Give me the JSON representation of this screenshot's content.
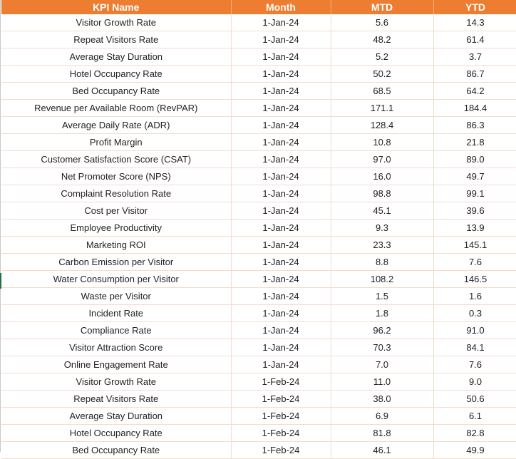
{
  "headers": [
    "KPI Name",
    "Month",
    "MTD",
    "YTD"
  ],
  "rows": [
    [
      "Visitor Growth Rate",
      "1-Jan-24",
      "5.6",
      "14.3"
    ],
    [
      "Repeat Visitors Rate",
      "1-Jan-24",
      "48.2",
      "61.4"
    ],
    [
      "Average Stay Duration",
      "1-Jan-24",
      "5.2",
      "3.7"
    ],
    [
      "Hotel Occupancy Rate",
      "1-Jan-24",
      "50.2",
      "86.7"
    ],
    [
      "Bed Occupancy Rate",
      "1-Jan-24",
      "68.5",
      "64.2"
    ],
    [
      "Revenue per Available Room (RevPAR)",
      "1-Jan-24",
      "171.1",
      "184.4"
    ],
    [
      "Average Daily Rate (ADR)",
      "1-Jan-24",
      "128.4",
      "86.3"
    ],
    [
      "Profit Margin",
      "1-Jan-24",
      "10.8",
      "21.8"
    ],
    [
      "Customer Satisfaction Score (CSAT)",
      "1-Jan-24",
      "97.0",
      "89.0"
    ],
    [
      "Net Promoter Score (NPS)",
      "1-Jan-24",
      "16.0",
      "49.7"
    ],
    [
      "Complaint Resolution Rate",
      "1-Jan-24",
      "98.8",
      "99.1"
    ],
    [
      "Cost per Visitor",
      "1-Jan-24",
      "45.1",
      "39.6"
    ],
    [
      "Employee Productivity",
      "1-Jan-24",
      "9.3",
      "13.9"
    ],
    [
      "Marketing ROI",
      "1-Jan-24",
      "23.3",
      "145.1"
    ],
    [
      "Carbon Emission per Visitor",
      "1-Jan-24",
      "8.8",
      "7.6"
    ],
    [
      "Water Consumption per Visitor",
      "1-Jan-24",
      "108.2",
      "146.5"
    ],
    [
      "Waste per Visitor",
      "1-Jan-24",
      "1.5",
      "1.6"
    ],
    [
      "Incident Rate",
      "1-Jan-24",
      "1.8",
      "0.3"
    ],
    [
      "Compliance Rate",
      "1-Jan-24",
      "96.2",
      "91.0"
    ],
    [
      "Visitor Attraction Score",
      "1-Jan-24",
      "70.3",
      "84.1"
    ],
    [
      "Online Engagement Rate",
      "1-Jan-24",
      "7.0",
      "7.6"
    ],
    [
      "Visitor Growth Rate",
      "1-Feb-24",
      "11.0",
      "9.0"
    ],
    [
      "Repeat Visitors Rate",
      "1-Feb-24",
      "38.0",
      "50.6"
    ],
    [
      "Average Stay Duration",
      "1-Feb-24",
      "6.9",
      "6.1"
    ],
    [
      "Hotel Occupancy Rate",
      "1-Feb-24",
      "81.8",
      "82.8"
    ],
    [
      "Bed Occupancy Rate",
      "1-Feb-24",
      "46.1",
      "49.9"
    ]
  ]
}
